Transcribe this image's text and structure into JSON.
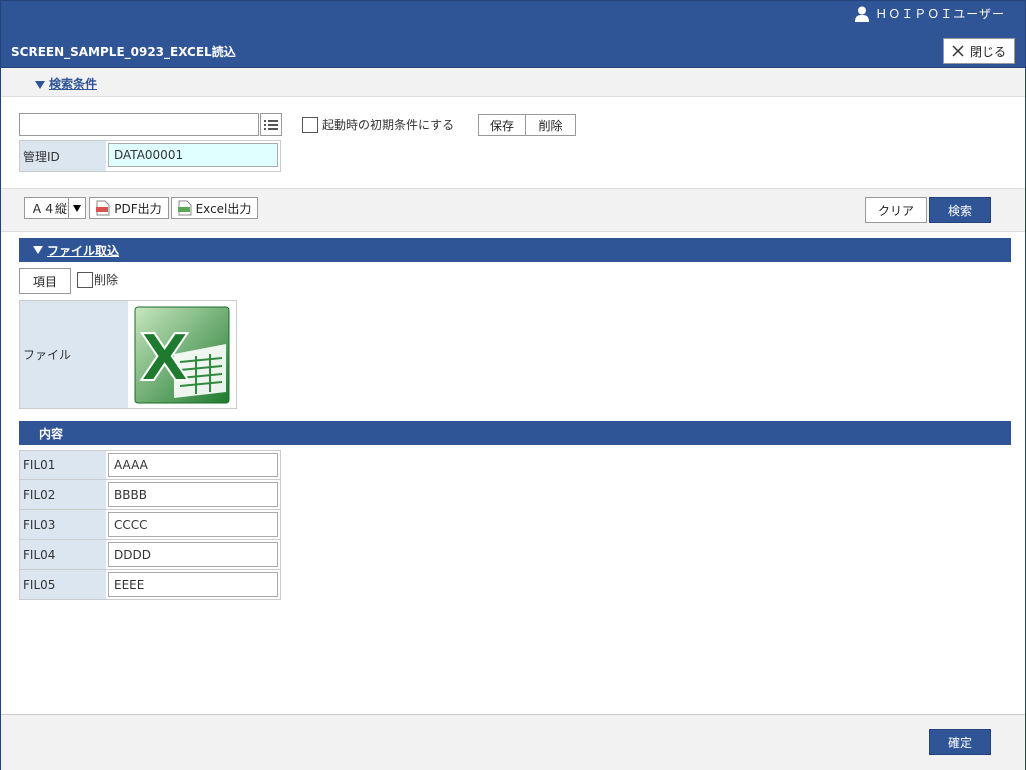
{
  "header": {
    "user_name": "ＨＯＩＰＯＩユーザー",
    "title": "SCREEN_SAMPLE_0923_EXCEL読込",
    "close_label": "閉じる"
  },
  "search": {
    "section_label": "検索条件",
    "condition_value": "",
    "init_condition_label": "起動時の初期条件にする",
    "save_label": "保存",
    "delete_label": "削除",
    "id_label": "管理ID",
    "id_value": "DATA00001"
  },
  "toolbar": {
    "paper_size": "Ａ４縦",
    "pdf_label": "PDF出力",
    "excel_label": "Excel出力",
    "clear_label": "クリア",
    "search_label": "検索"
  },
  "file_import": {
    "section_label": "ファイル取込",
    "item_button": "項目",
    "delete_label": "削除",
    "file_label": "ファイル"
  },
  "content": {
    "section_label": "内容",
    "rows": [
      {
        "label": "FIL01",
        "value": "AAAA"
      },
      {
        "label": "FIL02",
        "value": "BBBB"
      },
      {
        "label": "FIL03",
        "value": "CCCC"
      },
      {
        "label": "FIL04",
        "value": "DDDD"
      },
      {
        "label": "FIL05",
        "value": "EEEE"
      }
    ]
  },
  "footer": {
    "confirm_label": "確定"
  },
  "colors": {
    "primary": "#2f5597",
    "label_bg": "#dce6f1",
    "id_input_bg": "#e0ffff"
  }
}
